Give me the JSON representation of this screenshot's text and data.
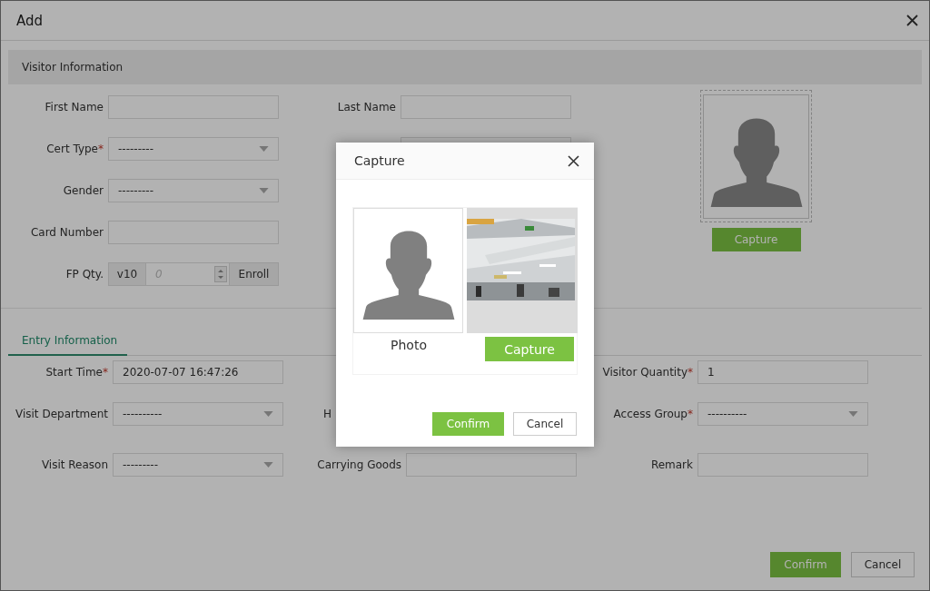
{
  "window": {
    "title": "Add"
  },
  "visitor_section": {
    "title": "Visitor Information",
    "left_fields": [
      {
        "kind": "text",
        "label": "First Name"
      },
      {
        "kind": "select",
        "label": "Cert Type",
        "mark": "*",
        "value": "---------"
      },
      {
        "kind": "select",
        "label": "Gender",
        "value": "---------"
      },
      {
        "kind": "text",
        "label": "Card Number"
      },
      {
        "kind": "fp",
        "label": "FP Qty.",
        "prefix": "v10",
        "placeholder": "0",
        "button": "Enroll"
      }
    ],
    "middle_fields": [
      {
        "kind": "text",
        "label": "Last Name"
      },
      {
        "kind": "covered-field"
      }
    ],
    "photo": {
      "button": "Capture"
    }
  },
  "entry_section": {
    "tab": {
      "label": "Entry Information",
      "selected": true
    },
    "columns": [
      [
        {
          "kind": "text",
          "label": "Start Time",
          "mark": "*",
          "value": "2020-07-07 16:47:26"
        },
        {
          "kind": "select",
          "label": "Visit Department",
          "value": "----------"
        },
        {
          "kind": "select",
          "label": "Visit Reason",
          "value": "---------"
        }
      ],
      [
        {
          "kind": "blank"
        },
        {
          "kind": "covered",
          "label": "H"
        },
        {
          "kind": "text",
          "label": "Carrying Goods"
        }
      ],
      [
        {
          "kind": "text",
          "label": "Visitor Quantity",
          "mark": "*",
          "value": "1"
        },
        {
          "kind": "select",
          "label": "Access Group",
          "mark": "*",
          "value": "----------"
        },
        {
          "kind": "text",
          "label": "Remark"
        }
      ]
    ]
  },
  "footer_buttons": [
    {
      "label": "Confirm",
      "kind": "primary"
    },
    {
      "label": "Cancel",
      "kind": "default"
    }
  ],
  "capture_dialog": {
    "title": "Capture",
    "photo_label": "Photo",
    "capture_button": "Capture",
    "buttons": [
      {
        "label": "Confirm",
        "kind": "primary"
      },
      {
        "label": "Cancel",
        "kind": "default"
      }
    ]
  }
}
